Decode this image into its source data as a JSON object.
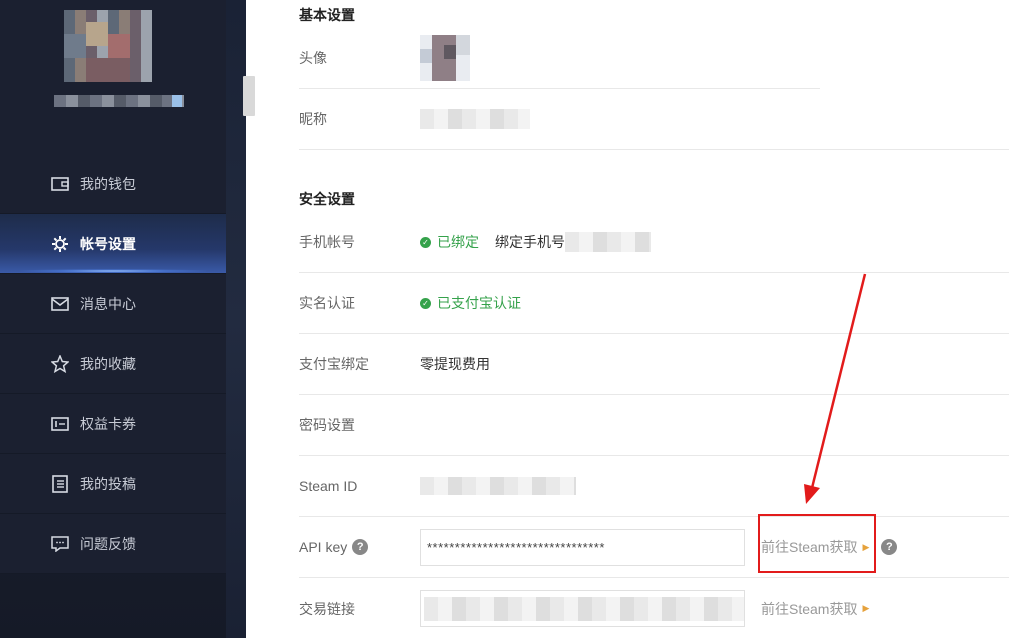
{
  "sidebar": {
    "items": [
      {
        "label": "我的钱包",
        "icon": "wallet-icon",
        "active": false
      },
      {
        "label": "帐号设置",
        "icon": "gear-icon",
        "active": true
      },
      {
        "label": "消息中心",
        "icon": "mail-icon",
        "active": false
      },
      {
        "label": "我的收藏",
        "icon": "star-icon",
        "active": false
      },
      {
        "label": "权益卡券",
        "icon": "coupon-icon",
        "active": false
      },
      {
        "label": "我的投稿",
        "icon": "document-icon",
        "active": false
      },
      {
        "label": "问题反馈",
        "icon": "chat-icon",
        "active": false
      }
    ]
  },
  "basic": {
    "title": "基本设置",
    "avatar_label": "头像",
    "nickname_label": "昵称"
  },
  "security": {
    "title": "安全设置",
    "phone_label": "手机帐号",
    "phone_status": "已绑定",
    "phone_bind_text": "绑定手机号",
    "realname_label": "实名认证",
    "realname_status": "已支付宝认证",
    "alipay_label": "支付宝绑定",
    "alipay_value": "零提现费用",
    "password_label": "密码设置",
    "steamid_label": "Steam ID",
    "apikey_label": "API key",
    "apikey_value": "********************************",
    "apikey_link": "前往Steam获取",
    "trade_label": "交易链接",
    "trade_link": "前往Steam获取"
  },
  "colors": {
    "accent_ok": "#35a24b",
    "annotation_red": "#e21b1b",
    "link_arrow": "#e6a23c"
  }
}
